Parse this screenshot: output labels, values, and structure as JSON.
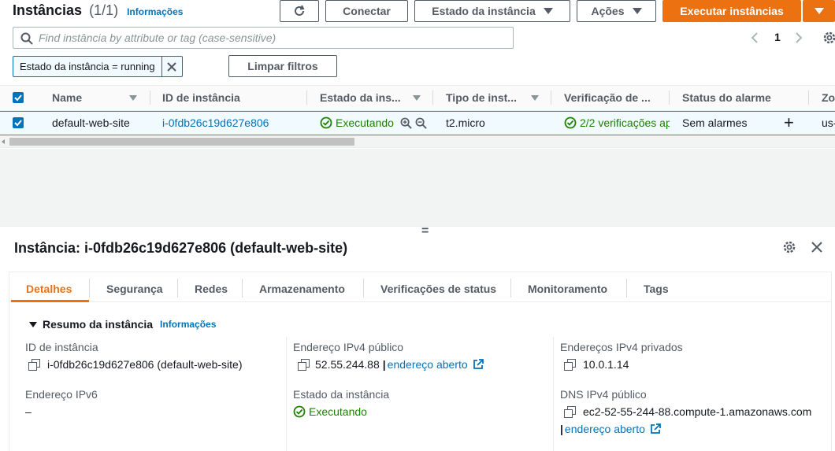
{
  "header": {
    "title": "Instâncias",
    "count": "(1/1)",
    "info": "Informações",
    "refresh_icon": "refresh-icon",
    "connect": "Conectar",
    "instance_state": "Estado da instância",
    "actions": "Ações",
    "launch": "Executar instâncias",
    "accent": "#ec7211"
  },
  "search": {
    "placeholder": "Find instância by attribute or tag (case-sensitive)"
  },
  "pagination": {
    "page": "1"
  },
  "filter": {
    "token": "Estado da instância = running",
    "clear": "Limpar filtros"
  },
  "table": {
    "columns": [
      "Name",
      "ID de instância",
      "Estado da ins...",
      "Tipo de inst...",
      "Verificação de ...",
      "Status do alarme",
      "Zo"
    ],
    "row": {
      "name": "default-web-site",
      "id": "i-0fdb26c19d627e806",
      "state": "Executando",
      "type": "t2.micro",
      "checks": "2/2 verificações ap",
      "alarm": "Sem alarmes",
      "add": "+",
      "zone": "us-"
    }
  },
  "splitter": "=",
  "detail": {
    "title": "Instância: i-0fdb26c19d627e806 (default-web-site)",
    "tabs": [
      "Detalhes",
      "Segurança",
      "Redes",
      "Armazenamento",
      "Verificações de status",
      "Monitoramento",
      "Tags"
    ],
    "summary": "Resumo da instância",
    "summary_info": "Informações",
    "fields": {
      "id_label": "ID de instância",
      "id_value": "i-0fdb26c19d627e806 (default-web-site)",
      "ipv6_label": "Endereço IPv6",
      "ipv6_value": "–",
      "pub_ip_label": "Endereço IPv4 público",
      "pub_ip_value": "52.55.244.88",
      "pub_ip_link": "endereço aberto",
      "pipe": "|",
      "state_label": "Estado da instância",
      "state_value": "Executando",
      "priv_ip_label": "Endereços IPv4 privados",
      "priv_ip_value": "10.0.1.14",
      "dns_label": "DNS IPv4 público",
      "dns_value": "ec2-52-55-244-88.compute-1.amazonaws.com",
      "dns_link": "endereço aberto"
    }
  },
  "colors": {
    "success": "#1d8102",
    "link": "#0073bb",
    "primary": "#ec7211"
  }
}
